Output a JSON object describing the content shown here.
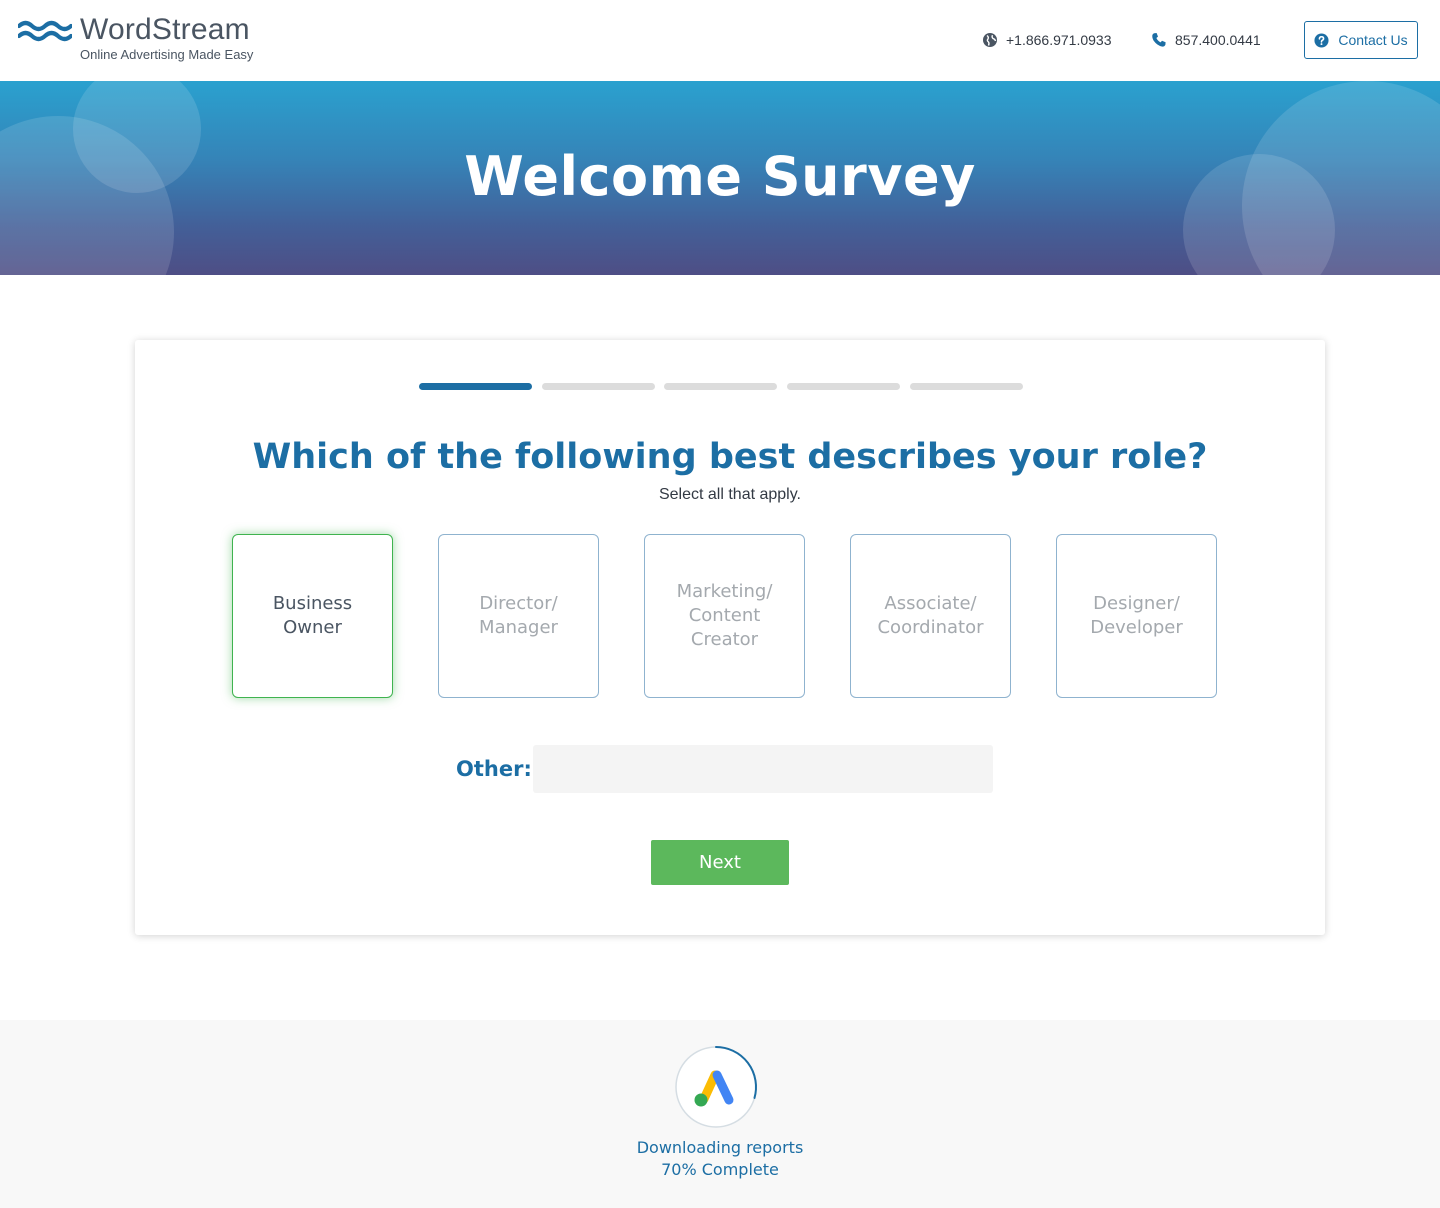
{
  "header": {
    "brand_name": "WordStream",
    "brand_tagline": "Online Advertising Made Easy",
    "intl_phone": "+1.866.971.0933",
    "local_phone": "857.400.0441",
    "contact_label": "Contact Us"
  },
  "hero": {
    "title": "Welcome Survey"
  },
  "survey": {
    "steps": [
      {
        "active": true
      },
      {
        "active": false
      },
      {
        "active": false
      },
      {
        "active": false
      },
      {
        "active": false
      }
    ],
    "question": "Which of the following best describes your role?",
    "hint": "Select all that apply.",
    "options": [
      {
        "label": "Business Owner",
        "selected": true
      },
      {
        "label": "Director/ Manager",
        "selected": false
      },
      {
        "label": "Marketing/ Content Creator",
        "selected": false
      },
      {
        "label": "Associate/ Coordinator",
        "selected": false
      },
      {
        "label": "Designer/ Developer",
        "selected": false
      }
    ],
    "other_label": "Other:",
    "other_value": "",
    "next_label": "Next"
  },
  "status": {
    "line1": "Downloading reports",
    "line2": "70% Complete",
    "progress_percent": 70
  },
  "colors": {
    "brand_blue": "#1c6ea4",
    "selected_green": "#3fb34f",
    "button_green": "#5cb85c"
  }
}
